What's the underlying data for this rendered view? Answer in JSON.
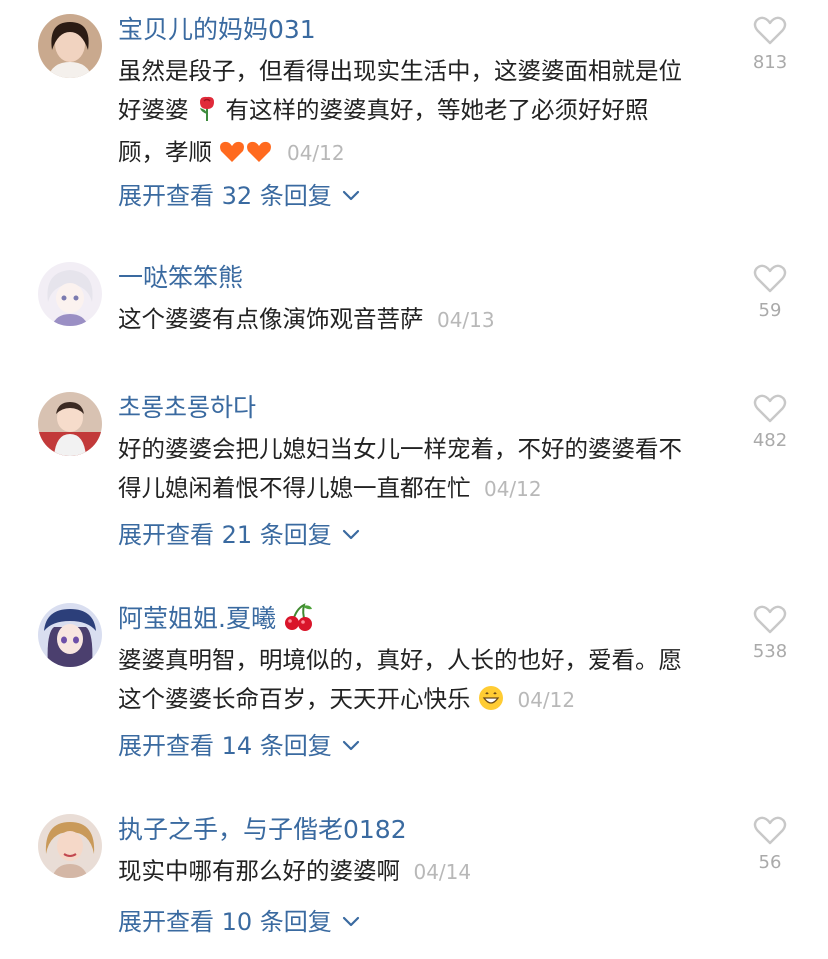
{
  "comments": [
    {
      "username": "宝贝儿的妈妈031",
      "lines": [
        "虽然是段子，但看得出现实生活中，这婆婆面相就是位",
        "好婆婆",
        "有这样的婆婆真好，等她老了必须好好照",
        "顾，孝顺"
      ],
      "date": "04/12",
      "likes": "813",
      "expand_label": "展开查看 32 条回复",
      "emoji": [
        "rose-emoji",
        "orange-heart-emoji"
      ]
    },
    {
      "username": "一哒笨笨熊",
      "text": "这个婆婆有点像演饰观音菩萨",
      "date": "04/13",
      "likes": "59"
    },
    {
      "username": "초롱초롱하다",
      "lines": [
        "好的婆婆会把儿媳妇当女儿一样宠着，不好的婆婆看不",
        "得儿媳闲着恨不得儿媳一直都在忙"
      ],
      "date": "04/12",
      "likes": "482",
      "expand_label": "展开查看 21 条回复"
    },
    {
      "username": "阿莹姐姐.夏曦",
      "lines": [
        "婆婆真明智，明境似的，真好，人长的也好，爱看。愿",
        "这个婆婆长命百岁，天天开心快乐"
      ],
      "date": "04/12",
      "likes": "538",
      "expand_label": "展开查看 14 条回复",
      "emoji": [
        "cherries-emoji",
        "grinning-face-emoji"
      ]
    },
    {
      "username": "执子之手，与子偕老0182",
      "text": "现实中哪有那么好的婆婆啊",
      "date": "04/14",
      "likes": "56",
      "expand_label": "展开查看 10 条回复"
    }
  ],
  "icons": {
    "like": "heart-outline-icon",
    "expand": "chevron-down-icon"
  },
  "colors": {
    "username": "#3a6aa0",
    "date": "#b8b8b8",
    "count": "#aaaaaa",
    "heart": "#c8c8c8"
  }
}
